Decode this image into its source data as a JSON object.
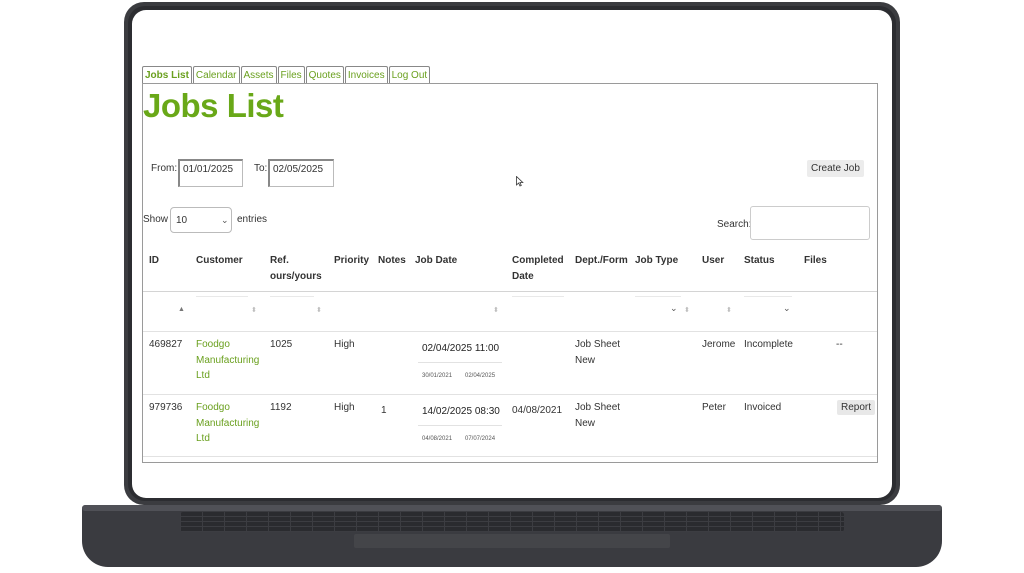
{
  "nav": {
    "tabs": [
      {
        "label": "Jobs List",
        "active": true
      },
      {
        "label": "Calendar"
      },
      {
        "label": "Assets"
      },
      {
        "label": "Files"
      },
      {
        "label": "Quotes"
      },
      {
        "label": "Invoices"
      },
      {
        "label": "Log Out"
      }
    ]
  },
  "page": {
    "title": "Jobs List"
  },
  "filters": {
    "from_label": "From:",
    "from_value": "01/01/2025",
    "to_label": "To:",
    "to_value": "02/05/2025",
    "create_job": "Create Job"
  },
  "table_controls": {
    "show_label": "Show",
    "entries_value": "10",
    "entries_label": "entries",
    "search_label": "Search:",
    "search_value": ""
  },
  "table": {
    "headers": {
      "id": "ID",
      "customer": "Customer",
      "ref_1": "Ref.",
      "ref_2": "ours/yours",
      "priority": "Priority",
      "notes": "Notes",
      "job_date": "Job Date",
      "completed_1": "Completed",
      "completed_2": "Date",
      "dept": "Dept./Form",
      "job_type": "Job Type",
      "user": "User",
      "status": "Status",
      "files": "Files"
    },
    "rows": [
      {
        "id": "469827",
        "customer": [
          "Foodgo",
          "Manufacturing",
          "Ltd"
        ],
        "ref": "1025",
        "priority": "High",
        "notes": "",
        "job_date": "02/04/2025 11:00",
        "job_date_sub1": "30/01/2021",
        "job_date_sub2": "02/04/2025",
        "completed": "",
        "dept": [
          "Job Sheet",
          "New"
        ],
        "job_type": "",
        "user": "Jerome",
        "status": "Incomplete",
        "files": "--"
      },
      {
        "id": "979736",
        "customer": [
          "Foodgo",
          "Manufacturing",
          "Ltd"
        ],
        "ref": "1192",
        "priority": "High",
        "notes": "1",
        "job_date": "14/02/2025 08:30",
        "job_date_sub1": "04/08/2021",
        "job_date_sub2": "07/07/2024",
        "completed": "04/08/2021",
        "dept": [
          "Job Sheet",
          "New"
        ],
        "job_type": "",
        "user": "Peter",
        "status": "Invoiced",
        "files": "Report"
      }
    ]
  },
  "colors": {
    "accent": "#69a818",
    "laptop": "#3b3c40"
  }
}
